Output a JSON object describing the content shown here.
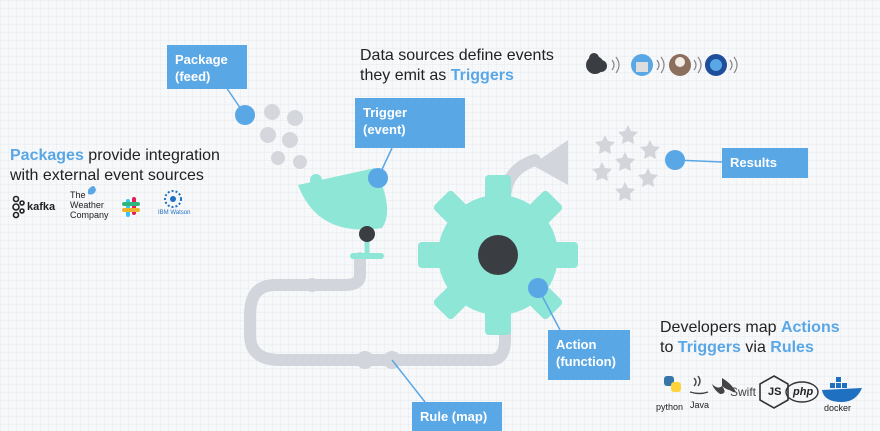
{
  "boxes": {
    "package": [
      "Package",
      "(feed)"
    ],
    "trigger": [
      "Trigger",
      "(event)"
    ],
    "results": "Results",
    "action": [
      "Action",
      "(function)"
    ],
    "rule": "Rule (map)"
  },
  "captions": {
    "data_sources": {
      "line1": "Data sources define events",
      "line2_pre": "they emit as ",
      "line2_hl": "Triggers"
    },
    "packages": {
      "line1_hl": "Packages",
      "line1_post": " provide integration",
      "line2": "with external event sources"
    },
    "developers": {
      "line1_pre": "Developers map ",
      "line1_hl": "Actions",
      "line2_pre": "to ",
      "line2_hl": "Triggers",
      "line2_mid": " via ",
      "line2_hl2": "Rules"
    }
  },
  "package_logos": {
    "kafka": "kafka",
    "weather": [
      "The",
      "Weather",
      "Company"
    ],
    "watson": "IBM Watson"
  },
  "runtime_logos": {
    "python": "python",
    "java": "Java",
    "swift": "Swift",
    "js": "JS",
    "php": "php",
    "docker": "docker"
  },
  "colors": {
    "accent": "#5aa7e6",
    "mint": "#8ee6d6",
    "track": "#d2d6dc",
    "hub": "#3a3d42"
  }
}
